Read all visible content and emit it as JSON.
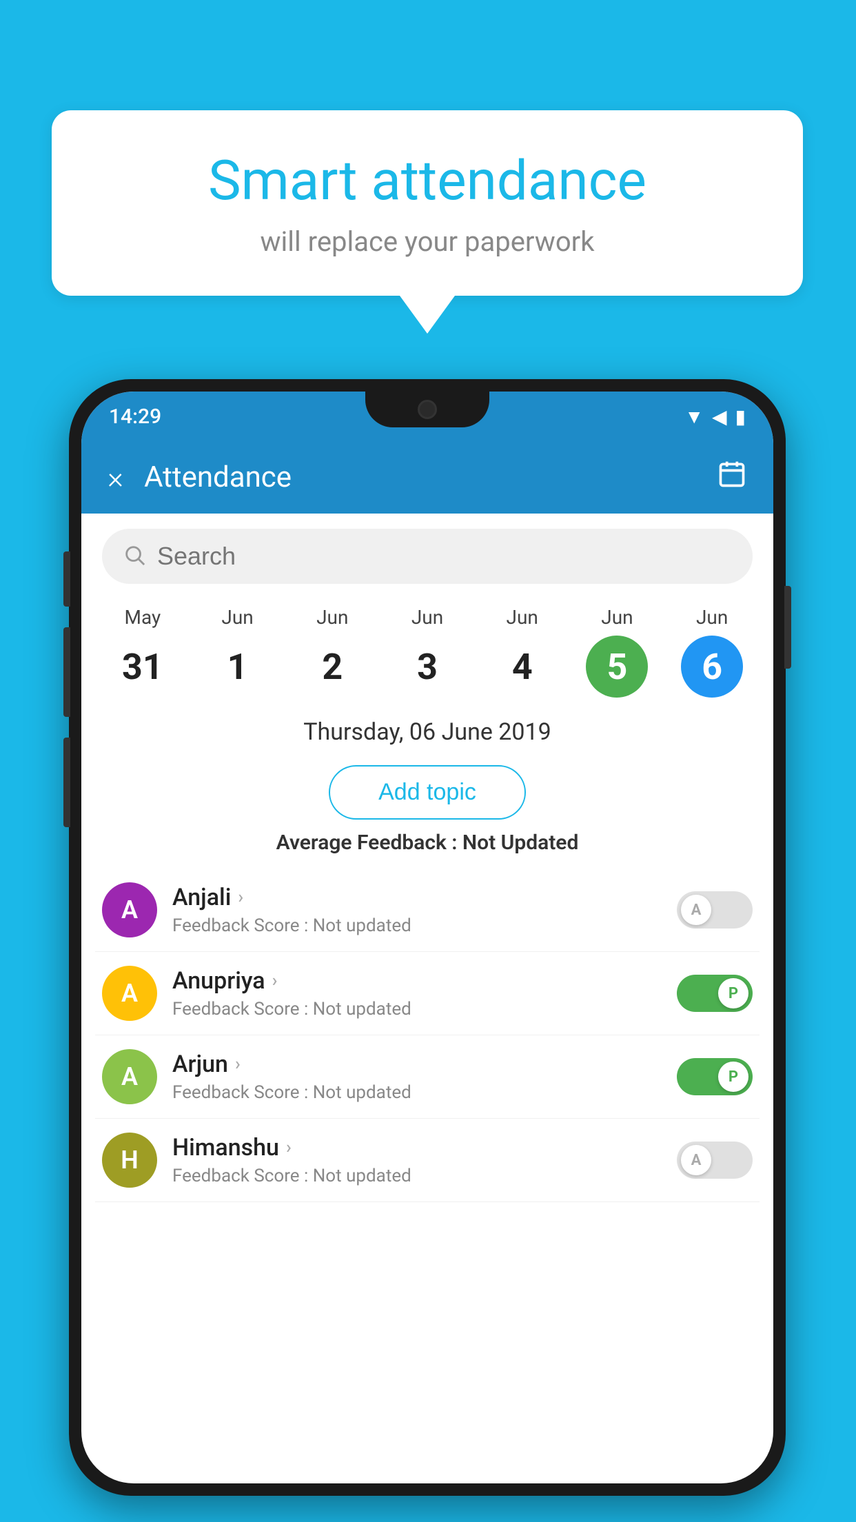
{
  "background_color": "#1BB8E8",
  "bubble": {
    "title": "Smart attendance",
    "subtitle": "will replace your paperwork"
  },
  "status_bar": {
    "time": "14:29",
    "icons": [
      "wifi",
      "signal",
      "battery"
    ]
  },
  "app_bar": {
    "title": "Attendance",
    "close_label": "×",
    "calendar_label": "📅"
  },
  "search": {
    "placeholder": "Search"
  },
  "calendar": {
    "days": [
      {
        "month": "May",
        "date": "31",
        "highlight": ""
      },
      {
        "month": "Jun",
        "date": "1",
        "highlight": ""
      },
      {
        "month": "Jun",
        "date": "2",
        "highlight": ""
      },
      {
        "month": "Jun",
        "date": "3",
        "highlight": ""
      },
      {
        "month": "Jun",
        "date": "4",
        "highlight": ""
      },
      {
        "month": "Jun",
        "date": "5",
        "highlight": "green"
      },
      {
        "month": "Jun",
        "date": "6",
        "highlight": "blue"
      }
    ],
    "selected_date": "Thursday, 06 June 2019"
  },
  "add_topic_label": "Add topic",
  "avg_feedback": {
    "label": "Average Feedback :",
    "value": "Not Updated"
  },
  "students": [
    {
      "name": "Anjali",
      "avatar_letter": "A",
      "avatar_color": "purple",
      "feedback": "Feedback Score : Not updated",
      "toggle_state": "off",
      "toggle_label": "A"
    },
    {
      "name": "Anupriya",
      "avatar_letter": "A",
      "avatar_color": "yellow",
      "feedback": "Feedback Score : Not updated",
      "toggle_state": "on",
      "toggle_label": "P"
    },
    {
      "name": "Arjun",
      "avatar_letter": "A",
      "avatar_color": "green",
      "feedback": "Feedback Score : Not updated",
      "toggle_state": "on",
      "toggle_label": "P"
    },
    {
      "name": "Himanshu",
      "avatar_letter": "H",
      "avatar_color": "olive",
      "feedback": "Feedback Score : Not updated",
      "toggle_state": "off",
      "toggle_label": "A"
    }
  ]
}
